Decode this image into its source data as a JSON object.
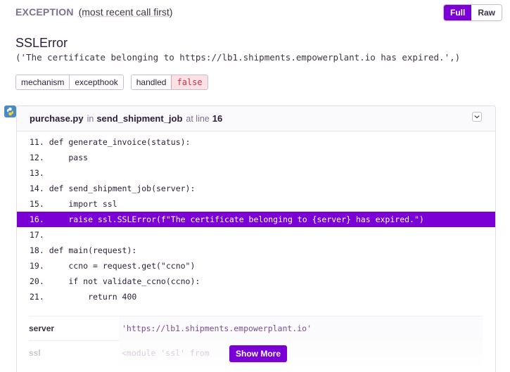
{
  "header": {
    "label": "EXCEPTION",
    "subtitle": "(most recent call first)"
  },
  "view_toggle": {
    "full_label": "Full",
    "raw_label": "Raw",
    "selected": "Full"
  },
  "exception": {
    "type": "SSLError",
    "value": "('The certificate belonging to https://lb1.shipments.empowerplant.io has expired.',)"
  },
  "tags": {
    "mechanism_key": "mechanism",
    "mechanism_value": "excepthook",
    "handled_key": "handled",
    "handled_value": "false"
  },
  "platform_icon": "python-icon",
  "frame": {
    "filename": "purchase.py",
    "in_text": "in",
    "function": "send_shipment_job",
    "at_text": "at line",
    "line": "16",
    "expand_icon": "chevron-down-icon",
    "code_lines": [
      "11. def generate_invoice(status):",
      "12.     pass",
      "13.",
      "14. def send_shipment_job(server):",
      "15.     import ssl",
      "16.     raise ssl.SSLError(f\"The certificate belonging to {server} has expired.\")",
      "17.",
      "18. def main(request):",
      "19.     ccno = request.get(\"ccno\")",
      "20.     if not validate_ccno(ccno):",
      "21.         return 400"
    ],
    "active_line_index": 5,
    "variables": [
      {
        "key": "server",
        "value": "'https://lb1.shipments.empowerplant.io'"
      },
      {
        "key": "ssl",
        "value": "<module 'ssl' from"
      }
    ],
    "show_more_label": "Show More"
  },
  "colors": {
    "accent": "#7a00d6",
    "false_badge_bg": "#fbe0e4",
    "false_badge_text": "#c4344f",
    "python_blue": "#4b8bbe",
    "python_yellow": "#ffd43b"
  }
}
